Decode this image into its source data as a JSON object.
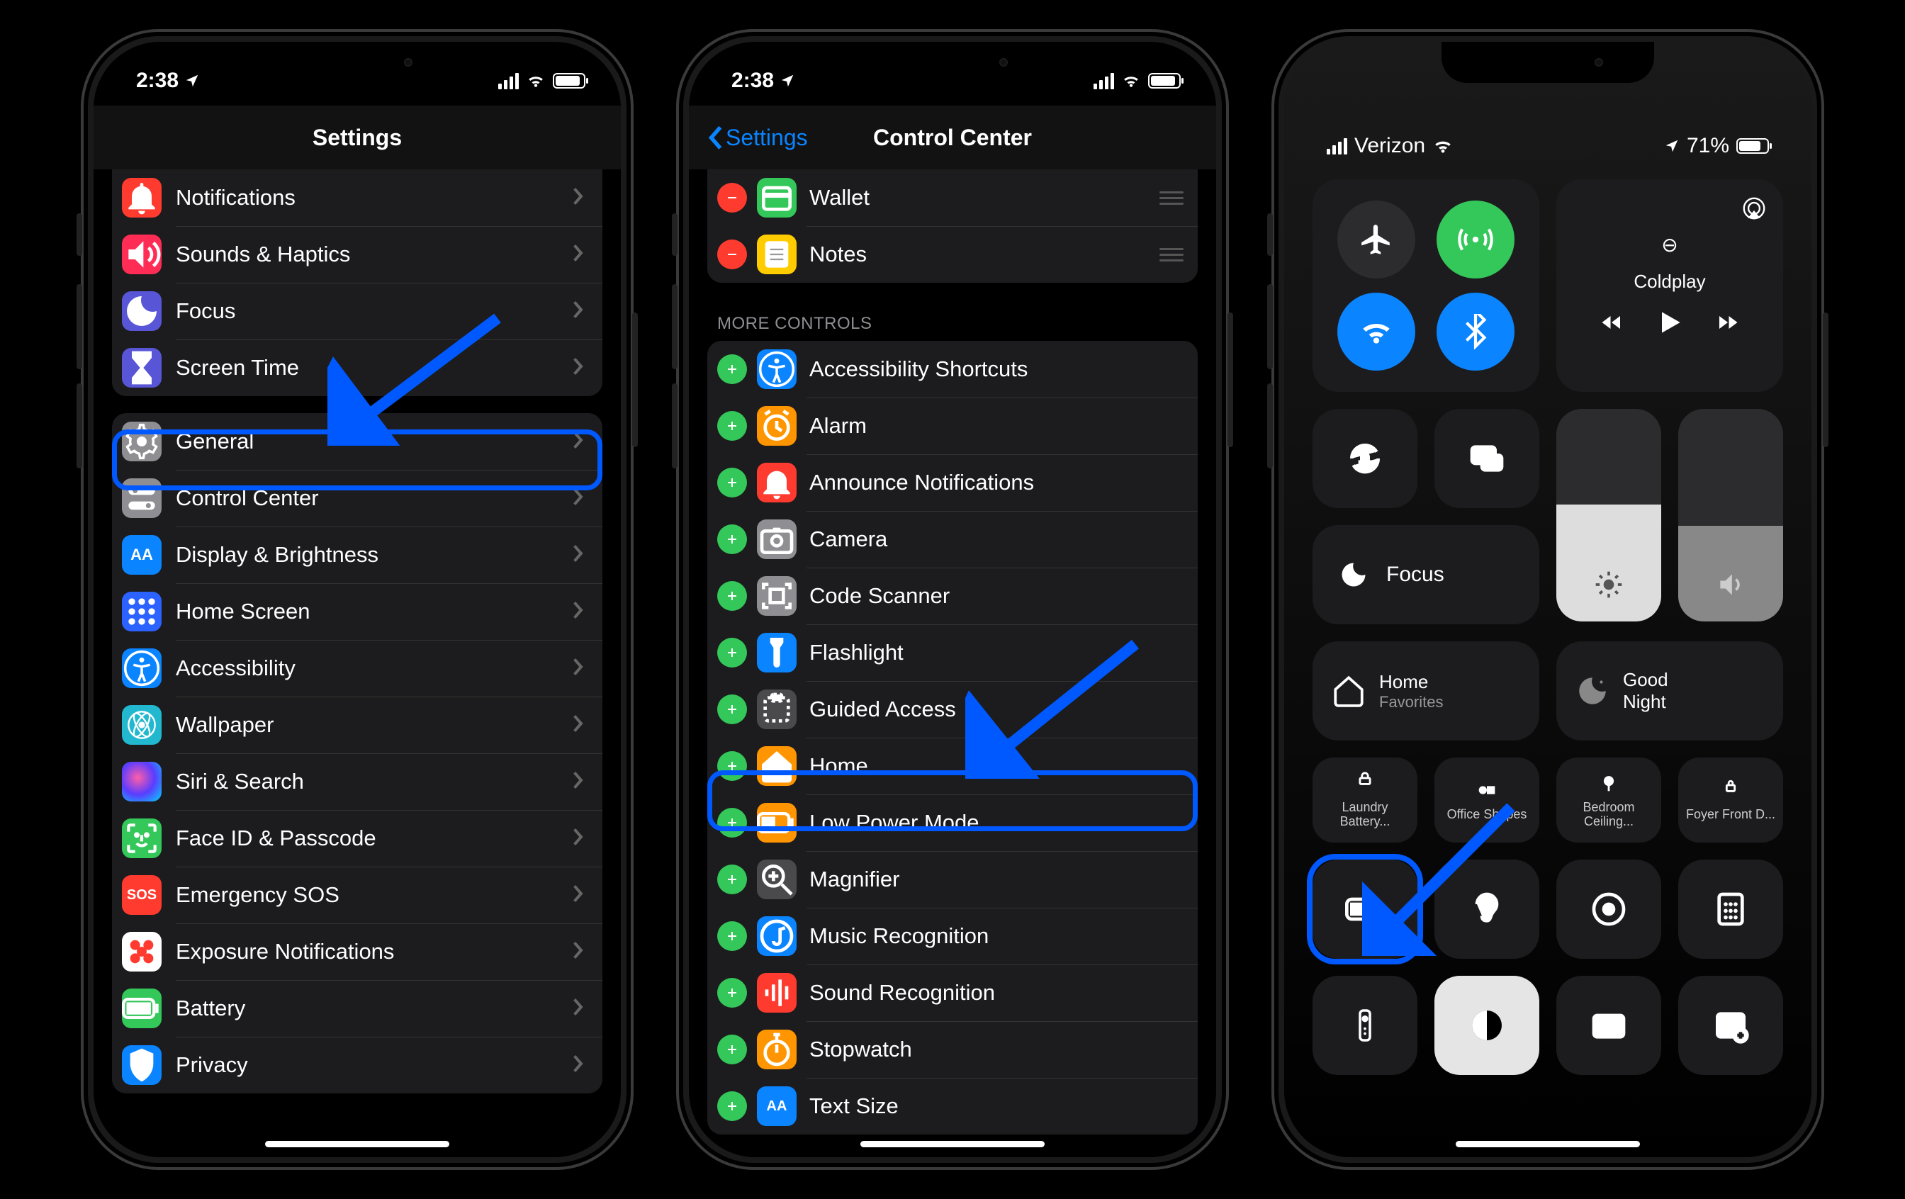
{
  "phone1": {
    "status": {
      "time": "2:38",
      "battery_pct": 80
    },
    "title": "Settings",
    "section1": [
      {
        "id": "notifications",
        "label": "Notifications",
        "color": "#ff3b30"
      },
      {
        "id": "sounds",
        "label": "Sounds & Haptics",
        "color": "#ff2d55"
      },
      {
        "id": "focus",
        "label": "Focus",
        "color": "#5856d6"
      },
      {
        "id": "screentime",
        "label": "Screen Time",
        "color": "#5856d6"
      }
    ],
    "section2": [
      {
        "id": "general",
        "label": "General",
        "color": "#8e8e93"
      },
      {
        "id": "controlcenter",
        "label": "Control Center",
        "color": "#8e8e93",
        "highlighted": true
      },
      {
        "id": "display",
        "label": "Display & Brightness",
        "color": "#0a84ff"
      },
      {
        "id": "homescreen",
        "label": "Home Screen",
        "color": "#2c62ff"
      },
      {
        "id": "accessibility",
        "label": "Accessibility",
        "color": "#0a84ff"
      },
      {
        "id": "wallpaper",
        "label": "Wallpaper",
        "color": "#22b8cf"
      },
      {
        "id": "siri",
        "label": "Siri & Search",
        "color": "#1c1c1e"
      },
      {
        "id": "faceid",
        "label": "Face ID & Passcode",
        "color": "#34c759"
      },
      {
        "id": "sos",
        "label": "Emergency SOS",
        "color": "#ff3b30",
        "text": "SOS"
      },
      {
        "id": "exposure",
        "label": "Exposure Notifications",
        "color": "#fff"
      },
      {
        "id": "battery",
        "label": "Battery",
        "color": "#34c759"
      },
      {
        "id": "privacy",
        "label": "Privacy",
        "color": "#0a84ff"
      }
    ]
  },
  "phone2": {
    "status": {
      "time": "2:38",
      "battery_pct": 80
    },
    "back": "Settings",
    "title": "Control Center",
    "included": [
      {
        "id": "wallet",
        "label": "Wallet",
        "color": "#34c759"
      },
      {
        "id": "notes",
        "label": "Notes",
        "color": "#ffcc00"
      }
    ],
    "more_header": "MORE CONTROLS",
    "more": [
      {
        "id": "a11yshortcuts",
        "label": "Accessibility Shortcuts",
        "color": "#0a84ff"
      },
      {
        "id": "alarm",
        "label": "Alarm",
        "color": "#ff9500"
      },
      {
        "id": "announce",
        "label": "Announce Notifications",
        "color": "#ff3b30"
      },
      {
        "id": "camera",
        "label": "Camera",
        "color": "#8e8e93"
      },
      {
        "id": "codescanner",
        "label": "Code Scanner",
        "color": "#8e8e93"
      },
      {
        "id": "flashlight",
        "label": "Flashlight",
        "color": "#0a84ff"
      },
      {
        "id": "guidedaccess",
        "label": "Guided Access",
        "color": "#4a4a4c"
      },
      {
        "id": "home",
        "label": "Home",
        "color": "#ff9500"
      },
      {
        "id": "lowpower",
        "label": "Low Power Mode",
        "color": "#ff9500",
        "highlighted": true
      },
      {
        "id": "magnifier",
        "label": "Magnifier",
        "color": "#4a4a4c"
      },
      {
        "id": "musicrec",
        "label": "Music Recognition",
        "color": "#0a84ff"
      },
      {
        "id": "soundrec",
        "label": "Sound Recognition",
        "color": "#ff3b30"
      },
      {
        "id": "stopwatch",
        "label": "Stopwatch",
        "color": "#ff9500"
      },
      {
        "id": "textsize",
        "label": "Text Size",
        "color": "#0a84ff"
      }
    ]
  },
  "phone3": {
    "status": {
      "carrier": "Verizon",
      "battery_label": "71%",
      "battery_pct": 71
    },
    "media": {
      "source_icon": "⊖",
      "artist": "Coldplay"
    },
    "focus_label": "Focus",
    "brightness_pct": 55,
    "volume_pct": 45,
    "home_tile": {
      "title": "Home",
      "sub": "Favorites"
    },
    "goodnight": {
      "title": "Good",
      "sub": "Night"
    },
    "tiny": [
      {
        "id": "laundry",
        "label": "Laundry Battery..."
      },
      {
        "id": "office",
        "label": "Office Shapes"
      },
      {
        "id": "bedroom",
        "label": "Bedroom Ceiling..."
      },
      {
        "id": "foyer",
        "label": "Foyer Front D..."
      }
    ]
  }
}
